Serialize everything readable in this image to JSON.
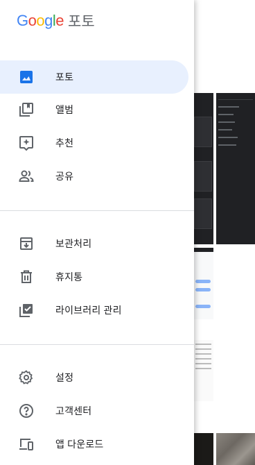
{
  "brand": {
    "logo_letters": [
      "G",
      "o",
      "o",
      "g",
      "l",
      "e"
    ],
    "logo_colors": [
      "#4285F4",
      "#EA4335",
      "#FBBC05",
      "#4285F4",
      "#34A853",
      "#EA4335"
    ],
    "product": "포토"
  },
  "colors": {
    "active_background": "#e8f0fe",
    "active_icon": "#1a73e8",
    "icon": "#5f6368"
  },
  "nav_primary": [
    {
      "label": "포토",
      "icon": "photo-icon",
      "active": true
    },
    {
      "label": "앨범",
      "icon": "album-icon",
      "active": false
    },
    {
      "label": "추천",
      "icon": "assistant-icon",
      "active": false
    },
    {
      "label": "공유",
      "icon": "people-icon",
      "active": false
    }
  ],
  "nav_library": [
    {
      "label": "보관처리",
      "icon": "archive-icon"
    },
    {
      "label": "휴지통",
      "icon": "trash-icon"
    },
    {
      "label": "라이브러리 관리",
      "icon": "library-manage-icon"
    }
  ],
  "nav_footer": [
    {
      "label": "설정",
      "icon": "settings-icon"
    },
    {
      "label": "고객센터",
      "icon": "help-icon"
    },
    {
      "label": "앱 다운로드",
      "icon": "devices-icon"
    }
  ]
}
